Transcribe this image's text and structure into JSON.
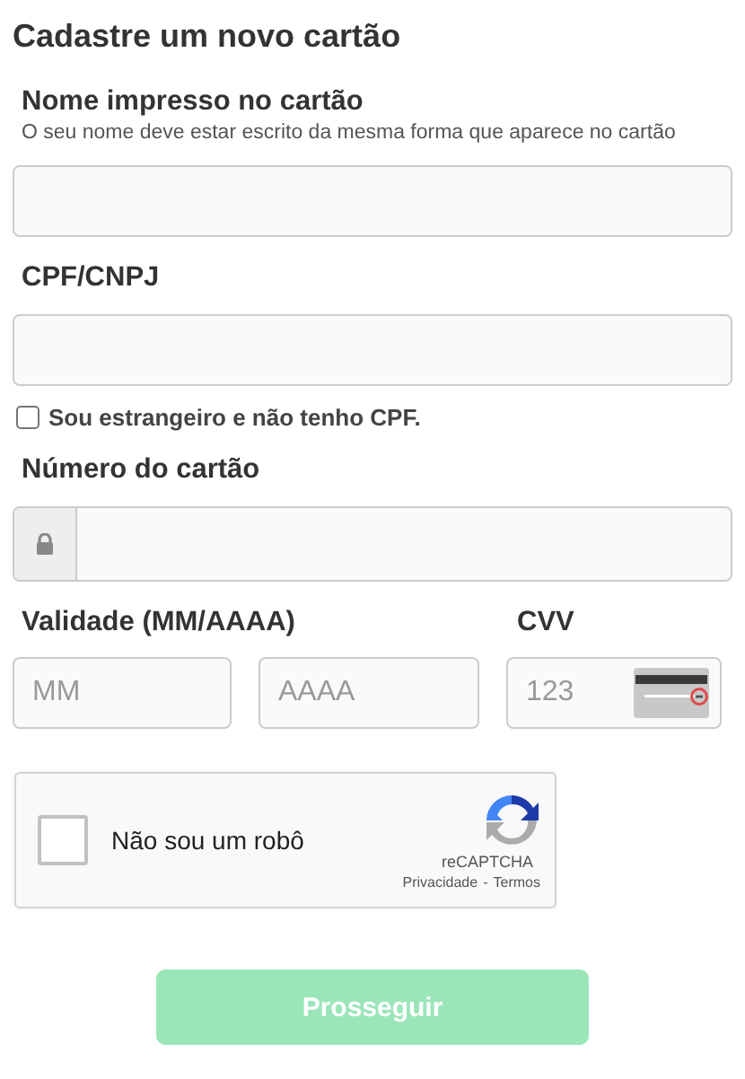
{
  "title": "Cadastre um novo cartão",
  "name_field": {
    "label": "Nome impresso no cartão",
    "hint": "O seu nome deve estar escrito da mesma forma que aparece no cartão"
  },
  "document_field": {
    "label": "CPF/CNPJ"
  },
  "foreign_checkbox": {
    "label": "Sou estrangeiro e não tenho CPF.",
    "checked": false
  },
  "card_number_field": {
    "label": "Número do cartão"
  },
  "expiry": {
    "label": "Validade (MM/AAAA)",
    "month_placeholder": "MM",
    "year_placeholder": "AAAA"
  },
  "cvv": {
    "label": "CVV",
    "placeholder": "123"
  },
  "captcha": {
    "label": "Não sou um robô",
    "checked": false,
    "brand": "reCAPTCHA",
    "privacy": "Privacidade",
    "separator": "-",
    "terms": "Termos"
  },
  "submit": {
    "label": "Prosseguir",
    "disabled": true
  }
}
